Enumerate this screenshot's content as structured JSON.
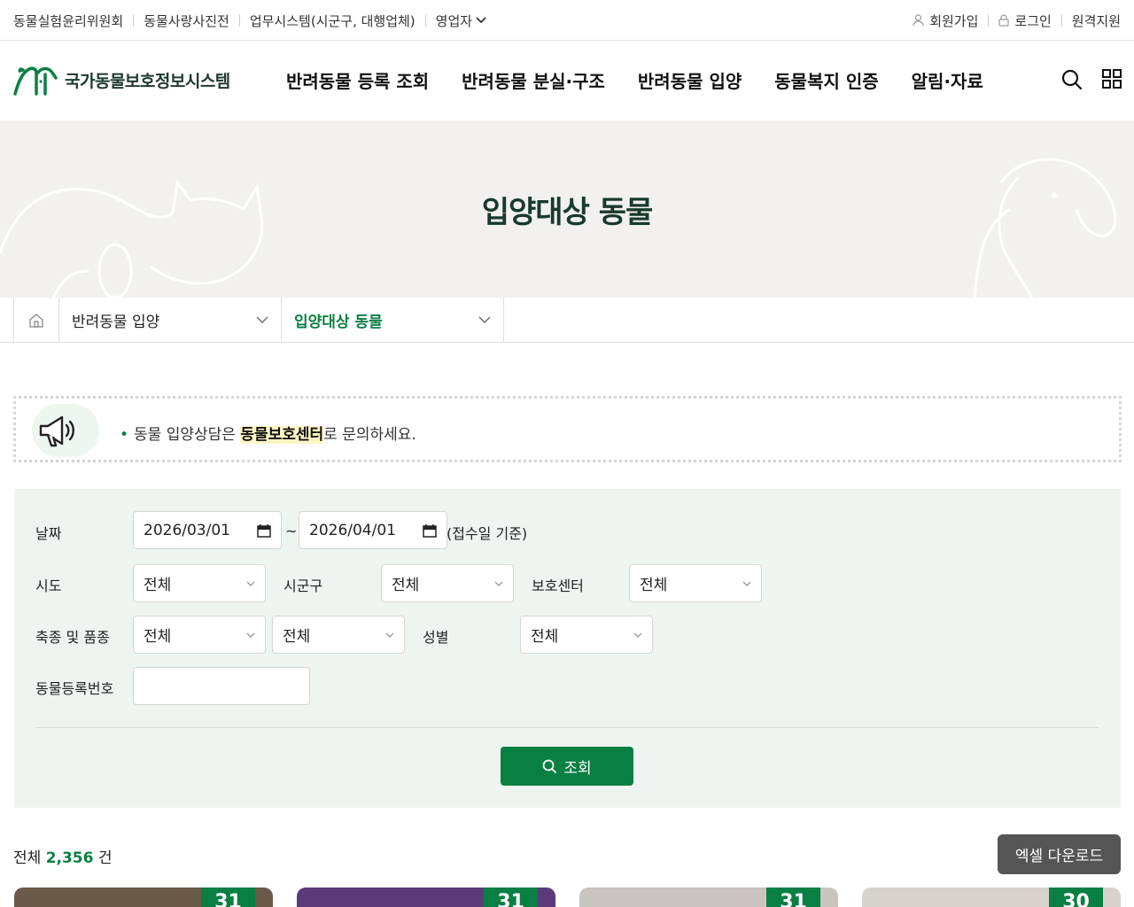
{
  "topbar": {
    "links": [
      "동물실험윤리위원회",
      "동물사랑사진전",
      "업무시스템(시군구, 대행업체)"
    ],
    "dropdown_label": "영업자",
    "signup": "회원가입",
    "login": "로그인",
    "remote": "원격지원"
  },
  "header": {
    "logo_text": "국가동물보호정보시스템",
    "nav": [
      "반려동물 등록 조회",
      "반려동물 분실·구조",
      "반려동물 입양",
      "동물복지 인증",
      "알림·자료"
    ],
    "brand_color": "#0a7f44"
  },
  "hero": {
    "title": "입양대상 동물"
  },
  "breadcrumb": {
    "level1": "반려동물 입양",
    "level2": "입양대상 동물"
  },
  "notice": {
    "before": "동물 입양상담은 ",
    "highlight": "동물보호센터",
    "after": "로 문의하세요."
  },
  "search": {
    "date_label": "날짜",
    "date_from": "2026/03/01",
    "date_to": "2026/04/01",
    "date_sep": "~",
    "date_note": "(접수일 기준)",
    "sido_label": "시도",
    "sido_value": "전체",
    "sigungu_label": "시군구",
    "sigungu_value": "전체",
    "center_label": "보호센터",
    "center_value": "전체",
    "species_label": "축종 및 품종",
    "species_value": "전체",
    "breed_value": "전체",
    "sex_label": "성별",
    "sex_value": "전체",
    "regno_label": "동물등록번호",
    "regno_value": "",
    "submit_label": "조회"
  },
  "results": {
    "prefix": "전체 ",
    "count": "2,356",
    "suffix": " 건",
    "excel_label": "엑셀 다운로드",
    "cards": [
      {
        "day": "31",
        "color": "#6b5a4a"
      },
      {
        "day": "31",
        "color": "#5b3a7a"
      },
      {
        "day": "31",
        "color": "#c8c4c0"
      },
      {
        "day": "30",
        "color": "#d8d2cc"
      }
    ]
  }
}
